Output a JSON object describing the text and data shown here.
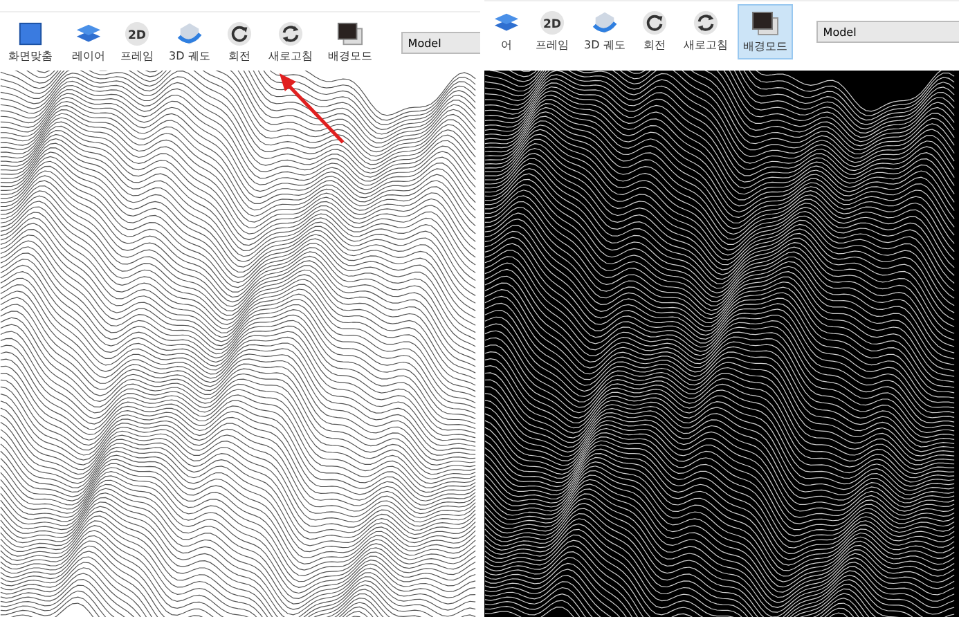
{
  "panels": [
    {
      "kind": "light",
      "tools": [
        {
          "label": "화면맞춤",
          "kind": "fit",
          "selected": false
        },
        {
          "label": "레이어",
          "kind": "layers",
          "selected": false
        },
        {
          "label": "프레임",
          "kind": "frame",
          "badge": "2D",
          "selected": false
        },
        {
          "label": "3D 궤도",
          "kind": "orbit",
          "selected": false
        },
        {
          "label": "회전",
          "kind": "rotate",
          "selected": false
        },
        {
          "label": "새로고침",
          "kind": "refresh",
          "selected": false
        },
        {
          "label": "배경모드",
          "kind": "background",
          "selected": false
        }
      ],
      "layout_field": {
        "value": "Model"
      }
    },
    {
      "kind": "dark",
      "tools": [
        {
          "label": "어",
          "kind": "layers",
          "selected": false
        },
        {
          "label": "프레임",
          "kind": "frame",
          "badge": "2D",
          "selected": false
        },
        {
          "label": "3D 궤도",
          "kind": "orbit",
          "selected": false
        },
        {
          "label": "회전",
          "kind": "rotate",
          "selected": false
        },
        {
          "label": "새로고침",
          "kind": "refresh",
          "selected": false
        },
        {
          "label": "배경모드",
          "kind": "background",
          "selected": true
        }
      ],
      "layout_field": {
        "value": "Model"
      }
    }
  ]
}
